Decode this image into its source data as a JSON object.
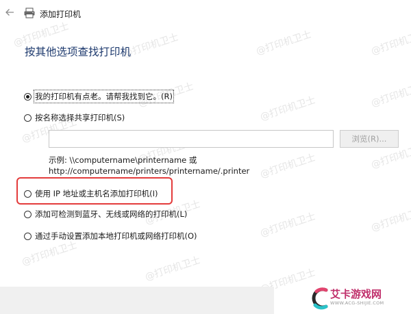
{
  "window": {
    "title": "添加打印机"
  },
  "heading": "按其他选项查找打印机",
  "options": [
    {
      "label": "我的打印机有点老。请帮我找到它。(R)",
      "checked": true
    },
    {
      "label": "按名称选择共享打印机(S)",
      "checked": false
    },
    {
      "label": "使用 IP 地址或主机名添加打印机(I)",
      "checked": false
    },
    {
      "label": "添加可检测到蓝牙、无线或网络的打印机(L)",
      "checked": false
    },
    {
      "label": "通过手动设置添加本地打印机或网络打印机(O)",
      "checked": false
    }
  ],
  "shared_printer": {
    "input_value": "",
    "browse_label": "浏览(R)...",
    "example_line1": "示例: \\\\computername\\printername 或",
    "example_line2": "http://computername/printers/printername/.printer"
  },
  "watermark_text": "@打印机卫士",
  "logo": {
    "text": "艾卡游戏网",
    "sub": "WWW.ACG-SHIJIE.COM"
  },
  "colors": {
    "heading": "#1e3a6e",
    "highlight": "#e33b3b",
    "footer": "#f0f0f0"
  },
  "icons": [
    "back-arrow-icon",
    "printer-icon"
  ]
}
